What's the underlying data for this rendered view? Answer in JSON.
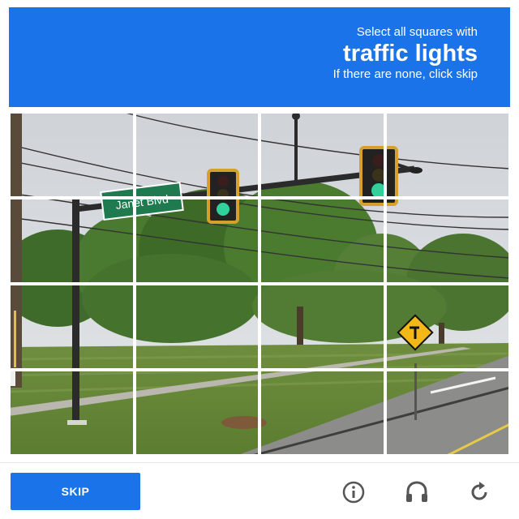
{
  "header": {
    "instruction": "Select all squares with",
    "target": "traffic lights",
    "hint": "If there are none, click skip"
  },
  "scene": {
    "street_sign": "Janet Blvd"
  },
  "grid": {
    "rows": 4,
    "cols": 4,
    "tiles": [
      {
        "row": 0,
        "col": 0,
        "selected": false
      },
      {
        "row": 0,
        "col": 1,
        "selected": false
      },
      {
        "row": 0,
        "col": 2,
        "selected": false
      },
      {
        "row": 0,
        "col": 3,
        "selected": false
      },
      {
        "row": 1,
        "col": 0,
        "selected": false
      },
      {
        "row": 1,
        "col": 1,
        "selected": false
      },
      {
        "row": 1,
        "col": 2,
        "selected": false
      },
      {
        "row": 1,
        "col": 3,
        "selected": false
      },
      {
        "row": 2,
        "col": 0,
        "selected": false
      },
      {
        "row": 2,
        "col": 1,
        "selected": false
      },
      {
        "row": 2,
        "col": 2,
        "selected": false
      },
      {
        "row": 2,
        "col": 3,
        "selected": false
      },
      {
        "row": 3,
        "col": 0,
        "selected": false
      },
      {
        "row": 3,
        "col": 1,
        "selected": false
      },
      {
        "row": 3,
        "col": 2,
        "selected": false
      },
      {
        "row": 3,
        "col": 3,
        "selected": false
      }
    ]
  },
  "footer": {
    "skip_label": "SKIP",
    "icons": [
      "info-icon",
      "headphones-icon",
      "reload-icon"
    ]
  },
  "colors": {
    "accent": "#1a73e8",
    "icon": "#555555"
  }
}
